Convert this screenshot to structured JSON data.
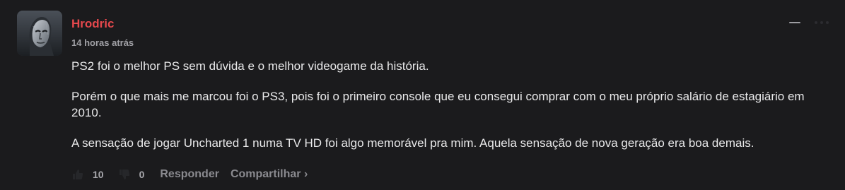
{
  "comment": {
    "author": "Hrodric",
    "timestamp": "14 horas atrás",
    "paragraphs": [
      "PS2 foi o melhor PS sem dúvida e o melhor videogame da história.",
      "Porém o que mais me marcou foi o PS3, pois foi o primeiro console que eu consegui comprar com o meu próprio salário de estagiário em 2010.",
      "A sensação de jogar Uncharted 1 numa TV HD foi algo memorável pra mim. Aquela sensação de nova geração era boa demais."
    ]
  },
  "actions": {
    "upvote_count": "10",
    "downvote_count": "0",
    "reply_label": "Responder",
    "share_label": "Compartilhar ›"
  },
  "icons": {
    "upvote": "thumbs-up-icon",
    "downvote": "thumbs-down-icon",
    "collapse": "minus-icon",
    "more": "more-options-icon"
  },
  "colors": {
    "background": "#1b1b1d",
    "author": "#e5484d",
    "text": "#e9e9ea",
    "muted": "#8a8a8f"
  }
}
